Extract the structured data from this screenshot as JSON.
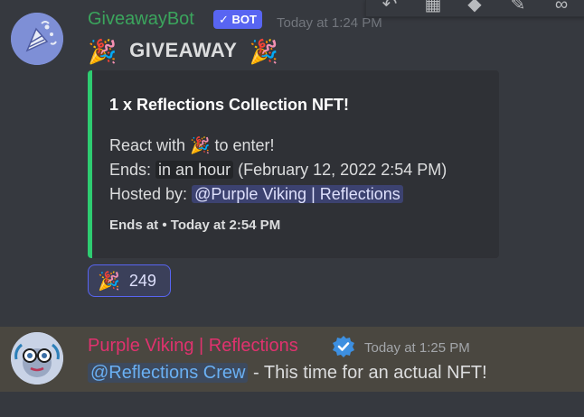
{
  "message1": {
    "username": "GiveawayBot",
    "bot_badge": "✓ BOT",
    "timestamp": "Today at 1:24 PM",
    "headline_emoji_left": "🎉",
    "headline": "GIVEAWAY",
    "headline_emoji_right": "🎉",
    "embed": {
      "accent_color": "#2ecc71",
      "title": "1 x Reflections Collection NFT!",
      "react_prefix": "React with",
      "react_emoji": "🎉",
      "react_suffix": "to enter!",
      "ends_label": "Ends:",
      "ends_relative": "in an hour",
      "ends_absolute": "(February 12, 2022 2:54 PM)",
      "hosted_label": "Hosted by:",
      "hosted_mention": "@Purple Viking | Reflections",
      "footer": "Ends at • Today at 2:54 PM"
    },
    "reaction": {
      "emoji": "🎉",
      "count": "249"
    }
  },
  "toolbar": {
    "icons": [
      "reply-icon",
      "thread-icon",
      "tag-icon",
      "pin-icon",
      "link-icon"
    ]
  },
  "message2": {
    "username": "Purple Viking | Reflections",
    "username_color": "#e0326e",
    "timestamp": "Today at 1:25 PM",
    "mention": "@Reflections Crew",
    "text": " - This time for an actual NFT!"
  }
}
